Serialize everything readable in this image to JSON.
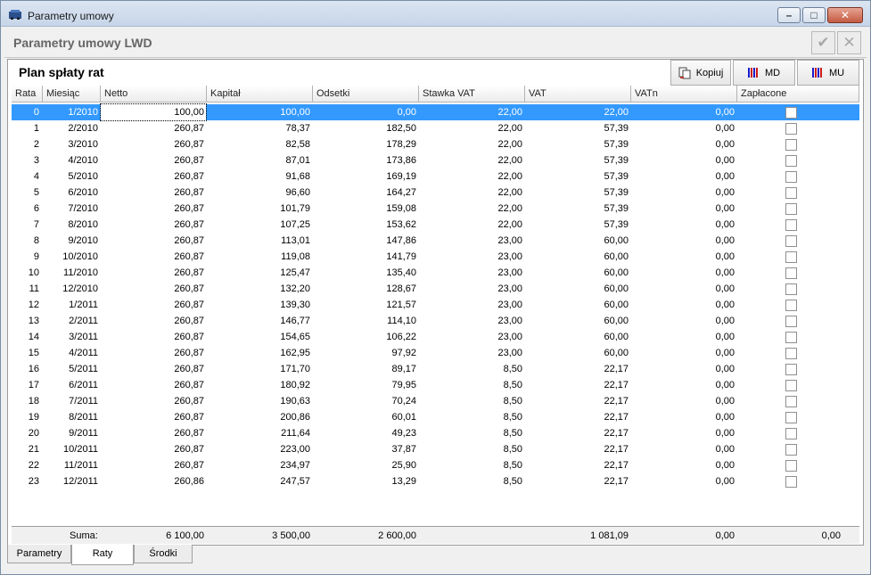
{
  "window": {
    "title": "Parametry umowy"
  },
  "header": {
    "title": "Parametry umowy LWD",
    "confirm_icon": "check-icon",
    "close_icon": "close-icon"
  },
  "panel": {
    "title": "Plan spłaty rat"
  },
  "toolbar": {
    "copy_label": "Kopiuj",
    "md_label": "MD",
    "mu_label": "MU"
  },
  "columns": [
    "Rata",
    "Miesiąc",
    "Netto",
    "Kapitał",
    "Odsetki",
    "Stawka VAT",
    "VAT",
    "VATn",
    "Zapłacone"
  ],
  "rows": [
    [
      "0",
      "1/2010",
      "100,00",
      "100,00",
      "0,00",
      "22,00",
      "22,00",
      "0,00"
    ],
    [
      "1",
      "2/2010",
      "260,87",
      "78,37",
      "182,50",
      "22,00",
      "57,39",
      "0,00"
    ],
    [
      "2",
      "3/2010",
      "260,87",
      "82,58",
      "178,29",
      "22,00",
      "57,39",
      "0,00"
    ],
    [
      "3",
      "4/2010",
      "260,87",
      "87,01",
      "173,86",
      "22,00",
      "57,39",
      "0,00"
    ],
    [
      "4",
      "5/2010",
      "260,87",
      "91,68",
      "169,19",
      "22,00",
      "57,39",
      "0,00"
    ],
    [
      "5",
      "6/2010",
      "260,87",
      "96,60",
      "164,27",
      "22,00",
      "57,39",
      "0,00"
    ],
    [
      "6",
      "7/2010",
      "260,87",
      "101,79",
      "159,08",
      "22,00",
      "57,39",
      "0,00"
    ],
    [
      "7",
      "8/2010",
      "260,87",
      "107,25",
      "153,62",
      "22,00",
      "57,39",
      "0,00"
    ],
    [
      "8",
      "9/2010",
      "260,87",
      "113,01",
      "147,86",
      "23,00",
      "60,00",
      "0,00"
    ],
    [
      "9",
      "10/2010",
      "260,87",
      "119,08",
      "141,79",
      "23,00",
      "60,00",
      "0,00"
    ],
    [
      "10",
      "11/2010",
      "260,87",
      "125,47",
      "135,40",
      "23,00",
      "60,00",
      "0,00"
    ],
    [
      "11",
      "12/2010",
      "260,87",
      "132,20",
      "128,67",
      "23,00",
      "60,00",
      "0,00"
    ],
    [
      "12",
      "1/2011",
      "260,87",
      "139,30",
      "121,57",
      "23,00",
      "60,00",
      "0,00"
    ],
    [
      "13",
      "2/2011",
      "260,87",
      "146,77",
      "114,10",
      "23,00",
      "60,00",
      "0,00"
    ],
    [
      "14",
      "3/2011",
      "260,87",
      "154,65",
      "106,22",
      "23,00",
      "60,00",
      "0,00"
    ],
    [
      "15",
      "4/2011",
      "260,87",
      "162,95",
      "97,92",
      "23,00",
      "60,00",
      "0,00"
    ],
    [
      "16",
      "5/2011",
      "260,87",
      "171,70",
      "89,17",
      "8,50",
      "22,17",
      "0,00"
    ],
    [
      "17",
      "6/2011",
      "260,87",
      "180,92",
      "79,95",
      "8,50",
      "22,17",
      "0,00"
    ],
    [
      "18",
      "7/2011",
      "260,87",
      "190,63",
      "70,24",
      "8,50",
      "22,17",
      "0,00"
    ],
    [
      "19",
      "8/2011",
      "260,87",
      "200,86",
      "60,01",
      "8,50",
      "22,17",
      "0,00"
    ],
    [
      "20",
      "9/2011",
      "260,87",
      "211,64",
      "49,23",
      "8,50",
      "22,17",
      "0,00"
    ],
    [
      "21",
      "10/2011",
      "260,87",
      "223,00",
      "37,87",
      "8,50",
      "22,17",
      "0,00"
    ],
    [
      "22",
      "11/2011",
      "260,87",
      "234,97",
      "25,90",
      "8,50",
      "22,17",
      "0,00"
    ],
    [
      "23",
      "12/2011",
      "260,86",
      "247,57",
      "13,29",
      "8,50",
      "22,17",
      "0,00"
    ]
  ],
  "summary": {
    "label": "Suma:",
    "netto": "6 100,00",
    "kapital": "3 500,00",
    "odsetki": "2 600,00",
    "vat": "1 081,09",
    "vatn": "0,00",
    "zaplacone": "0,00"
  },
  "tabs": [
    {
      "label": "Parametry",
      "active": false
    },
    {
      "label": "Raty",
      "active": true
    },
    {
      "label": "Środki",
      "active": false
    }
  ],
  "colors": {
    "selection": "#3399ff",
    "titlebar": "#c6d5e8"
  }
}
